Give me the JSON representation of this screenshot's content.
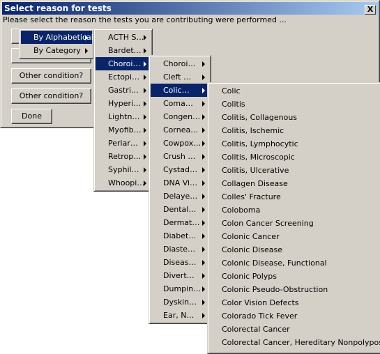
{
  "window": {
    "title": "Select reason for tests",
    "close_label": "X",
    "prompt": "Please select the reason the tests you are contributing were performed ..."
  },
  "buttons": {
    "hidden1": "",
    "hidden2": "",
    "other1": "Other condition?",
    "other2": "Other condition?",
    "done": "Done"
  },
  "colors": {
    "highlight": "#0a246a",
    "face": "#d4d0c8"
  },
  "menus": [
    {
      "selected": 0,
      "items": [
        "By Alphabetical",
        "By Category"
      ],
      "submenu": true
    },
    {
      "selected": 2,
      "items": [
        "ACTH S…",
        "Bardet…",
        "Choroi…",
        "Ectopi…",
        "Gastri…",
        "Hyperi…",
        "Lightn…",
        "Myofib…",
        "Periar…",
        "Retrop…",
        "Syphil…",
        "Whoopi…"
      ],
      "submenu": true
    },
    {
      "selected": 2,
      "items": [
        "Choroi…",
        "Cleft …",
        "Colic…",
        "Coma…",
        "Congen…",
        "Cornea…",
        "Cowpox…",
        "Crush …",
        "Cystad…",
        "DNA Vi…",
        "Delaye…",
        "Dental…",
        "Dermat…",
        "Diabet…",
        "Diaste…",
        "Diseas…",
        "Divert…",
        "Dumpin…",
        "Dyskin…",
        "Ear, N…"
      ],
      "submenu": true
    },
    {
      "selected": -1,
      "items": [
        "Colic",
        "Colitis",
        "Colitis, Collagenous",
        "Colitis, Ischemic",
        "Colitis, Lymphocytic",
        "Colitis, Microscopic",
        "Colitis, Ulcerative",
        "Collagen Disease",
        "Colles' Fracture",
        "Coloboma",
        "Colon Cancer Screening",
        "Colonic Cancer",
        "Colonic Disease",
        "Colonic Disease, Functional",
        "Colonic Polyps",
        "Colonic Pseudo-Obstruction",
        "Color Vision Defects",
        "Colorado Tick Fever",
        "Colorectal Cancer",
        "Colorectal Cancer, Hereditary Nonpolyposis"
      ],
      "submenu": false
    }
  ]
}
